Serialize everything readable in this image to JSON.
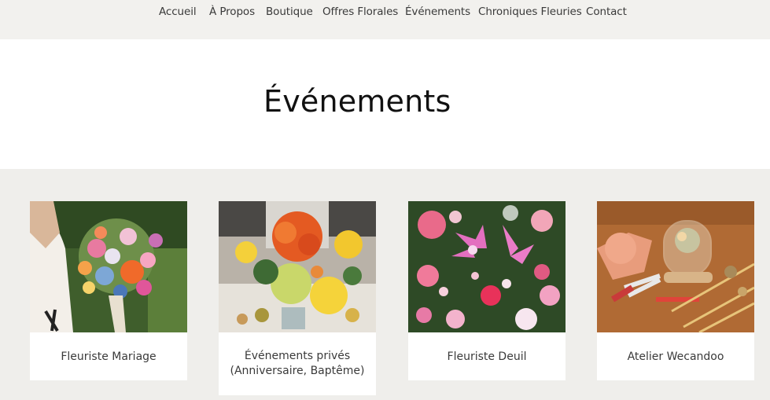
{
  "nav": {
    "items": [
      {
        "label": "Accueil"
      },
      {
        "label": "À Propos"
      },
      {
        "label": "Boutique"
      },
      {
        "label": "Offres Florales"
      },
      {
        "label": "Événements"
      },
      {
        "label": "Chroniques Fleuries"
      },
      {
        "label": "Contact"
      }
    ]
  },
  "hero": {
    "title": "Événements"
  },
  "cards": [
    {
      "label": "Fleuriste Mariage",
      "image": "bridal-bouquet-photo"
    },
    {
      "label_line1": "Événements privés",
      "label_line2": "(Anniversaire, Baptême)",
      "image": "event-table-flowers-photo"
    },
    {
      "label": "Fleuriste Deuil",
      "image": "lilies-roses-arrangement-photo"
    },
    {
      "label": "Atelier Wecandoo",
      "image": "dried-flowers-workshop-photo"
    }
  ],
  "colors": {
    "nav_bg": "#f2f1ee",
    "section_bg": "#efeeeb",
    "card_bg": "#ffffff",
    "text": "#3a3a3a"
  }
}
